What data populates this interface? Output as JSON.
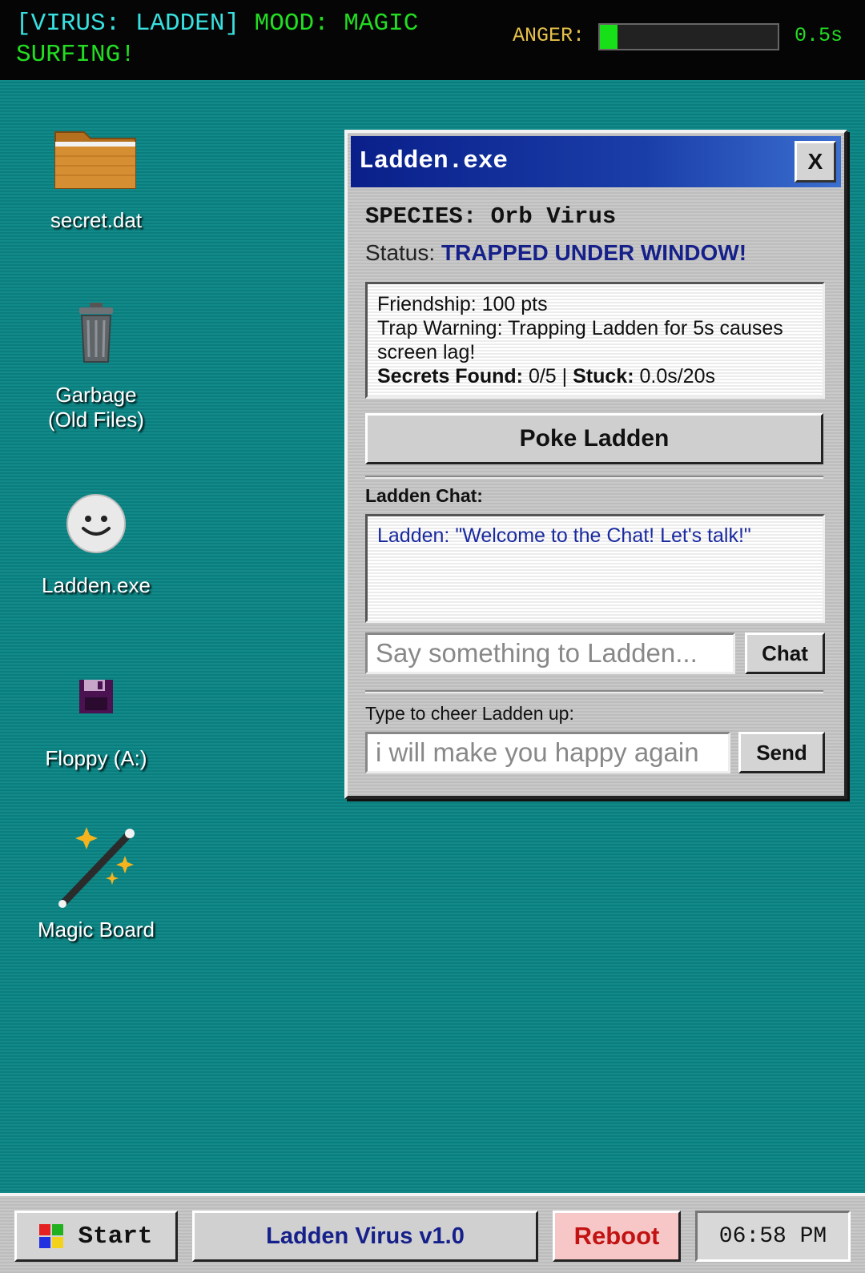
{
  "topbar": {
    "virus_tag": "[VIRUS: LADDEN]",
    "mood_label": "MOOD:",
    "mood_value": "MAGIC SURFING!",
    "anger_label": "ANGER:",
    "anger_level": 0.1,
    "timer": "0.5s"
  },
  "desktop": {
    "icons": [
      {
        "label": "secret.dat",
        "icon": "folder-icon"
      },
      {
        "label": "Garbage\n(Old Files)",
        "icon": "trash-icon"
      },
      {
        "label": "Ladden.exe",
        "icon": "smiley-icon"
      },
      {
        "label": "Floppy (A:)",
        "icon": "floppy-disk-icon"
      },
      {
        "label": "Magic Board",
        "icon": "magic-wand-icon"
      }
    ]
  },
  "window": {
    "title": "Ladden.exe",
    "close_label": "X",
    "species": "SPECIES: Orb Virus",
    "status_label": "Status:",
    "status_value": "TRAPPED UNDER WINDOW!",
    "info": {
      "friendship": "Friendship: 100 pts",
      "trap_warning": "Trap Warning: Trapping Ladden for 5s causes screen lag!",
      "secrets_label": "Secrets Found:",
      "secrets_value": "0/5",
      "separator": "|",
      "stuck_label": "Stuck:",
      "stuck_value": "0.0s/20s"
    },
    "poke_label": "Poke Ladden",
    "chat_label": "Ladden Chat:",
    "chat_message": "Ladden: \"Welcome to the Chat! Let's talk!\"",
    "chat_input_placeholder": "Say something to Ladden...",
    "chat_button": "Chat",
    "cheer_label": "Type to cheer Ladden up:",
    "cheer_input_placeholder": "i will make you happy again",
    "send_button": "Send"
  },
  "taskbar": {
    "start_label": "Start",
    "app_label": "Ladden Virus v1.0",
    "reboot_label": "Reboot",
    "clock": "06:58 PM"
  },
  "colors": {
    "desktop": "#0e8585",
    "title_bar": "#0a1f8a",
    "status_value": "#16208a",
    "anger_fill": "#18e018",
    "reboot_bg": "#f7c7c7",
    "reboot_text": "#c21212"
  }
}
